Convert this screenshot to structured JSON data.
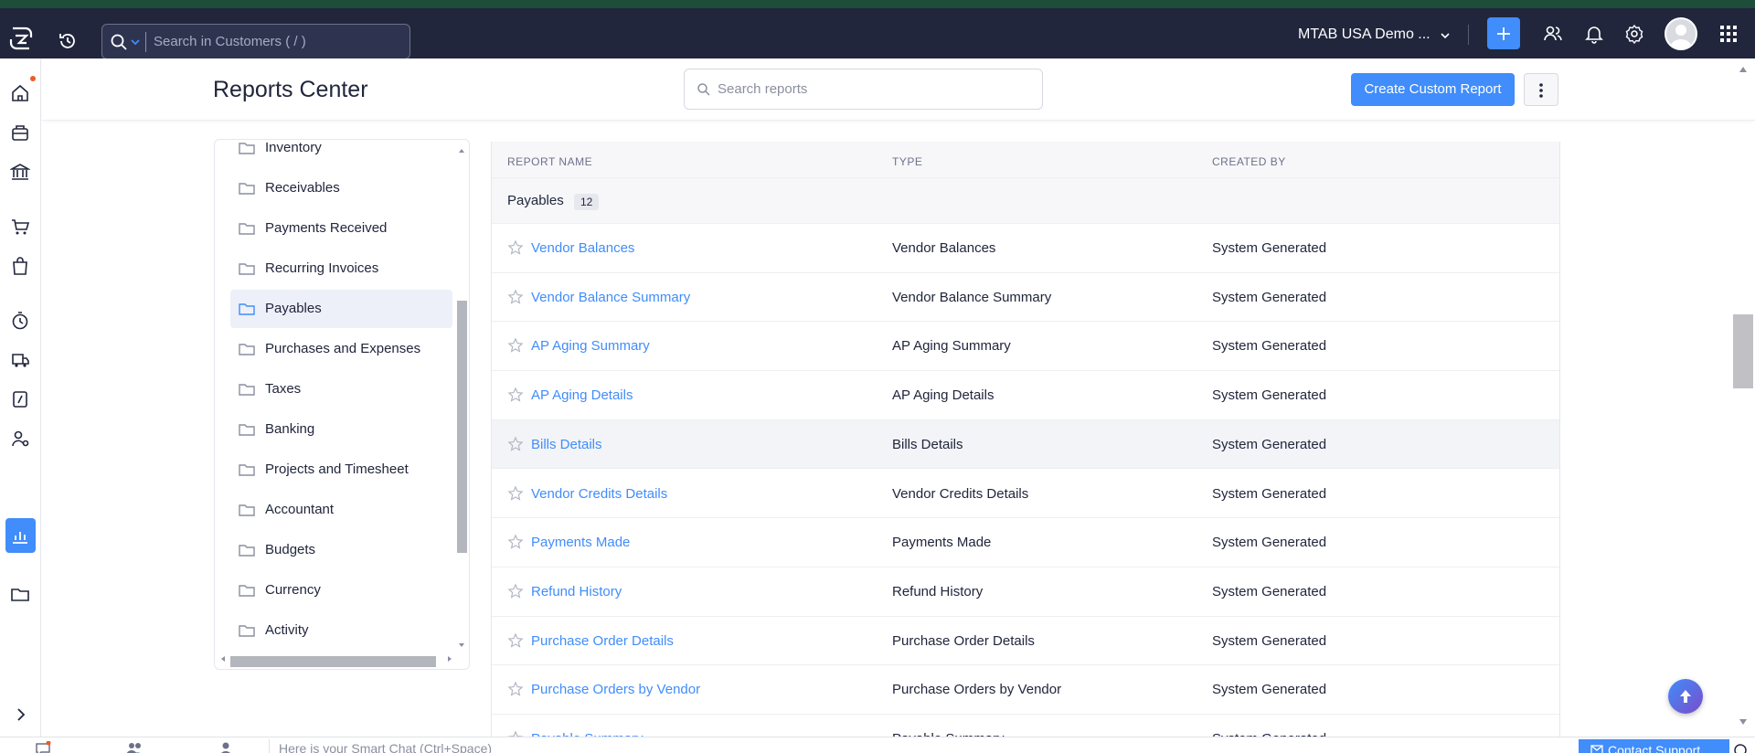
{
  "topbar": {
    "search_placeholder": "Search in Customers ( / )",
    "org_name": "MTAB USA Demo ..."
  },
  "header": {
    "title": "Reports Center",
    "search_placeholder": "Search reports",
    "create_label": "Create Custom Report"
  },
  "categories": [
    {
      "label": "Inventory",
      "active": false
    },
    {
      "label": "Receivables",
      "active": false
    },
    {
      "label": "Payments Received",
      "active": false
    },
    {
      "label": "Recurring Invoices",
      "active": false
    },
    {
      "label": "Payables",
      "active": true
    },
    {
      "label": "Purchases and Expenses",
      "active": false
    },
    {
      "label": "Taxes",
      "active": false
    },
    {
      "label": "Banking",
      "active": false
    },
    {
      "label": "Projects and Timesheet",
      "active": false
    },
    {
      "label": "Accountant",
      "active": false
    },
    {
      "label": "Budgets",
      "active": false
    },
    {
      "label": "Currency",
      "active": false
    },
    {
      "label": "Activity",
      "active": false
    }
  ],
  "table": {
    "columns": [
      "REPORT NAME",
      "TYPE",
      "CREATED BY"
    ],
    "group": {
      "name": "Payables",
      "count": "12"
    },
    "rows": [
      {
        "name": "Vendor Balances",
        "type": "Vendor Balances",
        "created_by": "System Generated"
      },
      {
        "name": "Vendor Balance Summary",
        "type": "Vendor Balance Summary",
        "created_by": "System Generated"
      },
      {
        "name": "AP Aging Summary",
        "type": "AP Aging Summary",
        "created_by": "System Generated"
      },
      {
        "name": "AP Aging Details",
        "type": "AP Aging Details",
        "created_by": "System Generated"
      },
      {
        "name": "Bills Details",
        "type": "Bills Details",
        "created_by": "System Generated"
      },
      {
        "name": "Vendor Credits Details",
        "type": "Vendor Credits Details",
        "created_by": "System Generated"
      },
      {
        "name": "Payments Made",
        "type": "Payments Made",
        "created_by": "System Generated"
      },
      {
        "name": "Refund History",
        "type": "Refund History",
        "created_by": "System Generated"
      },
      {
        "name": "Purchase Order Details",
        "type": "Purchase Order Details",
        "created_by": "System Generated"
      },
      {
        "name": "Purchase Orders by Vendor",
        "type": "Purchase Orders by Vendor",
        "created_by": "System Generated"
      },
      {
        "name": "Payable Summary",
        "type": "Payable Summary",
        "created_by": "System Generated"
      }
    ]
  },
  "bottombar": {
    "smartchat_placeholder": "Here is your Smart Chat (Ctrl+Space)",
    "contact_label": "Contact Support"
  },
  "colors": {
    "topbar_bg": "#21263c",
    "accent": "#408dfb",
    "active_category_bg": "#edf0f9",
    "notification_dot": "#f05a28"
  },
  "icons": {
    "topbar": [
      "app-logo-icon",
      "history-icon",
      "search-icon",
      "chevron-down-icon",
      "plus-icon",
      "users-icon",
      "bell-icon",
      "gear-icon",
      "avatar",
      "apps-grid-icon"
    ],
    "rail": [
      "home-icon",
      "items-icon",
      "banking-icon",
      "sales-cart-icon",
      "purchases-bag-icon",
      "time-tracking-icon",
      "ewaybill-icon",
      "documents-icon",
      "accountant-icon",
      "reports-chart-icon",
      "files-icon",
      "expand-icon"
    ]
  }
}
